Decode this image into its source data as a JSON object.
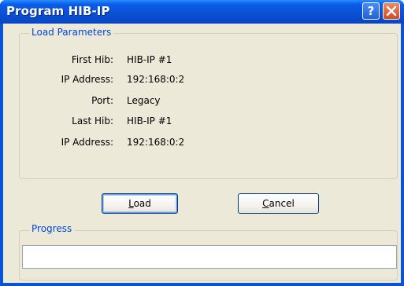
{
  "window": {
    "title": "Program HIB-IP",
    "help_label": "?",
    "close_icon": "close-icon"
  },
  "load_parameters": {
    "legend": "Load Parameters",
    "rows": [
      {
        "label": "First Hib:",
        "value": "HIB-IP #1"
      },
      {
        "label": "IP Address:",
        "value": "192:168:0:2"
      },
      {
        "label": "Port:",
        "value": "Legacy"
      },
      {
        "label": "Last Hib:",
        "value": "HIB-IP #1"
      },
      {
        "label": "IP Address:",
        "value": "192:168:0:2"
      }
    ]
  },
  "buttons": {
    "load": {
      "accel": "L",
      "rest": "oad"
    },
    "cancel": {
      "accel": "C",
      "rest": "ancel"
    }
  },
  "progress": {
    "legend": "Progress",
    "value": 0
  },
  "colors": {
    "titlebar": "#0a53d8",
    "dialog_bg": "#ece9d8",
    "group_legend": "#0046d5",
    "close_button": "#d3481e"
  }
}
